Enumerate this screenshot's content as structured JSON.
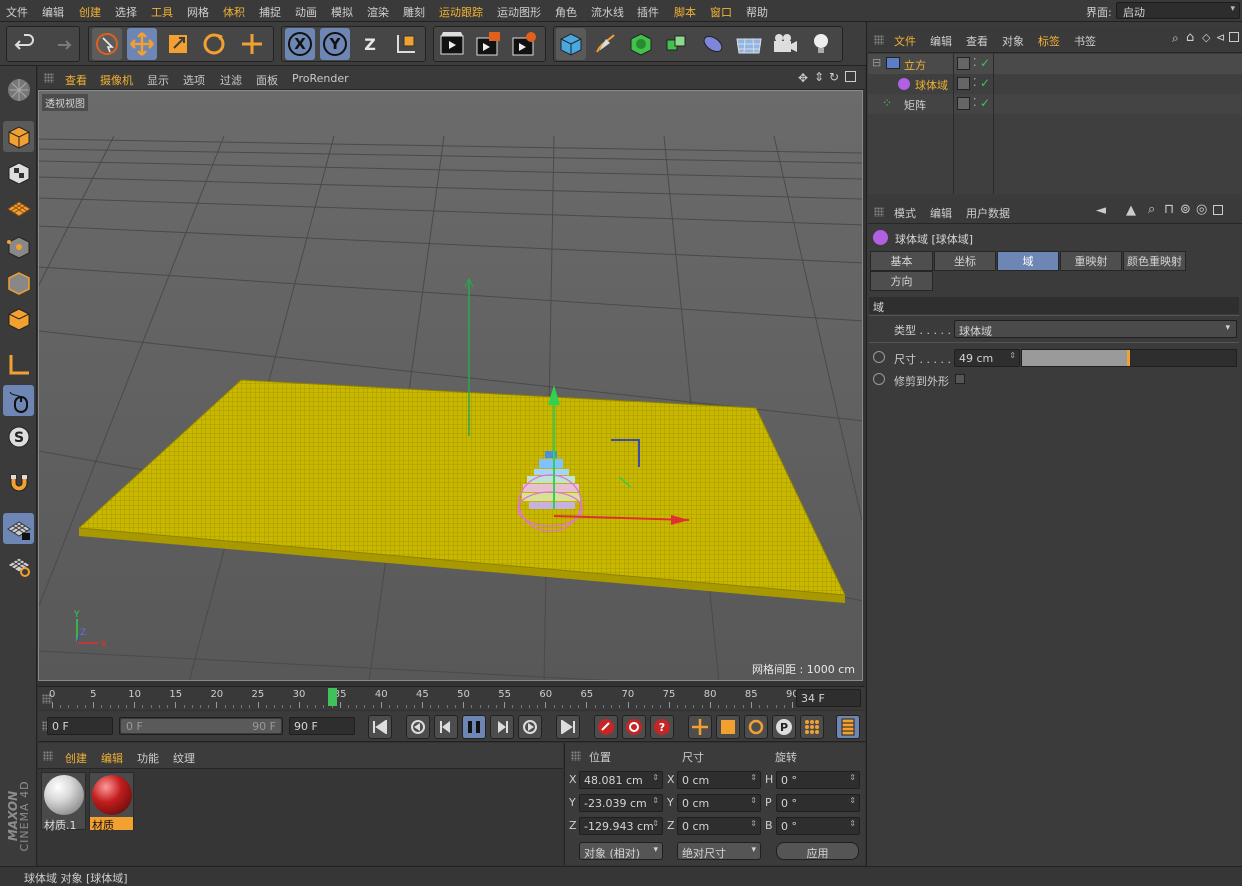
{
  "menubar": {
    "items": [
      "文件",
      "编辑",
      "创建",
      "选择",
      "工具",
      "网格",
      "体积",
      "捕捉",
      "动画",
      "模拟",
      "渲染",
      "雕刻",
      "运动跟踪",
      "运动图形",
      "角色",
      "流水线",
      "插件",
      "脚本",
      "窗口",
      "帮助"
    ],
    "interface_label": "界面:",
    "interface_value": "启动"
  },
  "toolbar": {
    "axis_x": "X",
    "axis_y": "Y",
    "axis_z": "Z"
  },
  "viewport": {
    "menu": [
      "查看",
      "摄像机",
      "显示",
      "选项",
      "过滤",
      "面板",
      "ProRender"
    ],
    "label": "透视视图",
    "grid_spacing": "网格间距 : 1000 cm",
    "axis_labels": {
      "y": "Y",
      "z": "Z",
      "x": "X"
    }
  },
  "timeline": {
    "ticks": [
      "0",
      "5",
      "10",
      "15",
      "20",
      "25",
      "30",
      "35",
      "40",
      "45",
      "50",
      "55",
      "60",
      "65",
      "70",
      "75",
      "80",
      "85",
      "90"
    ],
    "current_frame": 34,
    "current_frame_label": "34 F",
    "max_frame": 90
  },
  "transport": {
    "start_field": "0 F",
    "range_start": "0 F",
    "range_end": "90 F",
    "end_field": "90 F"
  },
  "materials": {
    "menu": [
      "创建",
      "编辑",
      "功能",
      "纹理"
    ],
    "items": [
      {
        "name": "材质.1",
        "color": "#d9d9d9"
      },
      {
        "name": "材质",
        "color": "#c21d1d"
      }
    ]
  },
  "coordinates": {
    "headers": [
      "位置",
      "尺寸",
      "旋转"
    ],
    "rows": [
      {
        "axis": "X",
        "pos": "48.081 cm",
        "size_axis": "X",
        "size": "0 cm",
        "rot_axis": "H",
        "rot": "0 °"
      },
      {
        "axis": "Y",
        "pos": "-23.039 cm",
        "size_axis": "Y",
        "size": "0 cm",
        "rot_axis": "P",
        "rot": "0 °"
      },
      {
        "axis": "Z",
        "pos": "-129.943 cm",
        "size_axis": "Z",
        "size": "0 cm",
        "rot_axis": "B",
        "rot": "0 °"
      }
    ],
    "mode_select": "对象 (相对)",
    "size_select": "绝对尺寸",
    "apply_label": "应用"
  },
  "objects": {
    "menu": [
      "文件",
      "编辑",
      "查看",
      "对象",
      "标签",
      "书签"
    ],
    "tree": [
      {
        "name": "立方",
        "color": "#f2b233"
      },
      {
        "name": "球体域",
        "color": "#f2b233"
      },
      {
        "name": "矩阵",
        "color": "#cfcfcf"
      }
    ]
  },
  "attributes": {
    "menu": [
      "模式",
      "编辑",
      "用户数据"
    ],
    "object_title": "球体域 [球体域]",
    "tabs": [
      "基本",
      "坐标",
      "域",
      "重映射",
      "颜色重映射",
      "方向"
    ],
    "selected_tab": "域",
    "section": "域",
    "type_label": "类型 . . . . . .",
    "type_value": "球体域",
    "size_label": "尺寸 . . . . .",
    "size_value": "49 cm",
    "clip_label": "修剪到外形"
  },
  "status": {
    "text": "球体域 对象 [球体域]"
  },
  "brand": {
    "line1": "MAXON",
    "line2": "CINEMA 4D"
  },
  "colors": {
    "accent": "#f2b233",
    "selected_tab": "#6d86b3",
    "plane": "#c8b400"
  }
}
